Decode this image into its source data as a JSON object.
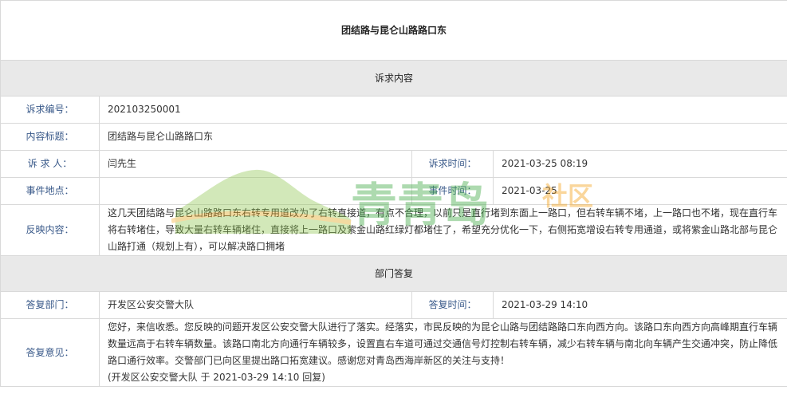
{
  "page_title": "团结路与昆仑山路路口东",
  "sections": {
    "appeal": "诉求内容",
    "reply": "部门答复"
  },
  "appeal": {
    "number_label": "诉求编号：",
    "number_value": "202103250001",
    "subject_label": "内容标题：",
    "subject_value": "团结路与昆仑山路路口东",
    "person_label": "诉 求 人：",
    "person_value": "闫先生",
    "time_label": "诉求时间：",
    "time_value": "2021-03-25 08:19",
    "location_label": "事件地点：",
    "location_value": "",
    "event_time_label": "事件时间：",
    "event_time_value": "2021-03-25",
    "content_label": "反映内容：",
    "content_value": "这几天团结路与昆仑山路路口东右转专用道改为了右转直接道，有点不合理，以前只是直行堵到东面上一路口，但右转车辆不堵，上一路口也不堵，现在直行车将右转堵住，导致大量右转车辆堵住，直接将上一路口及紫金山路红绿灯都堵住了，希望充分优化一下，右侧拓宽增设右转专用通道，或将紫金山路北部与昆仑山路打通（规划上有），可以解决路口拥堵"
  },
  "reply": {
    "dept_label": "答复部门：",
    "dept_value": "开发区公安交警大队",
    "time_label": "答复时间：",
    "time_value": "2021-03-29 14:10",
    "opinion_label": "答复意见：",
    "opinion_value": "您好，来信收悉。您反映的问题开发区公安交警大队进行了落实。经落实，市民反映的为昆仑山路与团结路路口东向西方向。该路口东向西方向高峰期直行车辆数量远高于右转车辆数量。该路口南北方向通行车辆较多，设置直右车道可通过交通信号灯控制右转车辆，减少右转车辆与南北向车辆产生交通冲突，防止降低路口通行效率。交警部门已向区里提出路口拓宽建议。感谢您对青岛西海岸新区的关注与支持！",
    "signature": "(开发区公安交警大队 于 2021-03-29 14:10 回复)"
  },
  "watermark": {
    "text_main": "青青岛",
    "text_sub": "社区",
    "colors": {
      "mountain": "#8bc34a",
      "text": "#4caf50",
      "sub": "#f5a623"
    }
  }
}
